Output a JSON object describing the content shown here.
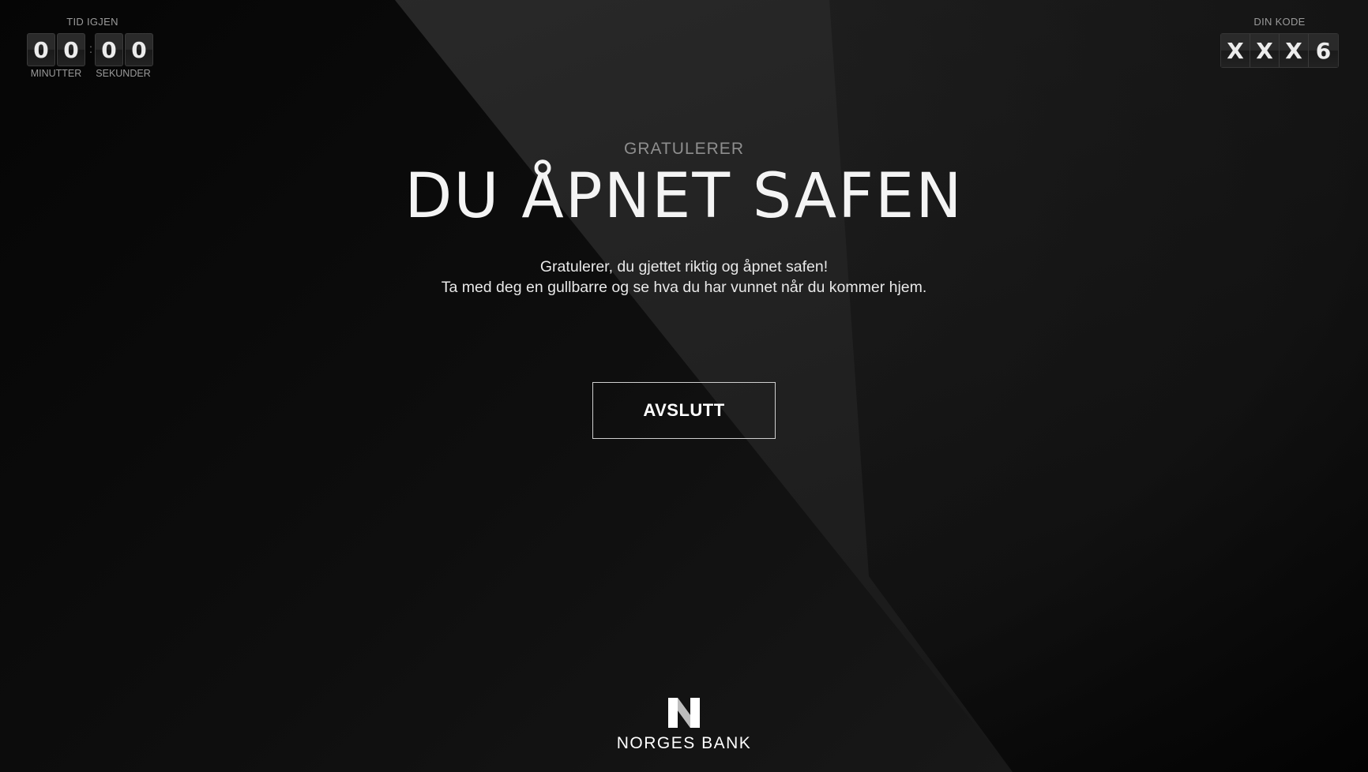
{
  "timer": {
    "title": "TID IGJEN",
    "digits": [
      "0",
      "0",
      "0",
      "0"
    ],
    "separator": ":",
    "minutes_label": "MINUTTER",
    "seconds_label": "SEKUNDER"
  },
  "code": {
    "title": "DIN KODE",
    "digits": [
      "X",
      "X",
      "X",
      "6"
    ]
  },
  "main": {
    "kicker": "GRATULERER",
    "headline": "DU ÅPNET SAFEN",
    "line1": "Gratulerer, du gjettet riktig og åpnet safen!",
    "line2": "Ta med deg en gullbarre og se hva du har vunnet når du kommer hjem.",
    "button_label": "AVSLUTT"
  },
  "footer": {
    "logo_icon": "norges-bank-n-icon",
    "logo_text": "NORGES BANK"
  },
  "colors": {
    "background": "#0d0d0d",
    "band": "#262626",
    "text": "#ffffff",
    "muted": "#9a9a9a"
  }
}
